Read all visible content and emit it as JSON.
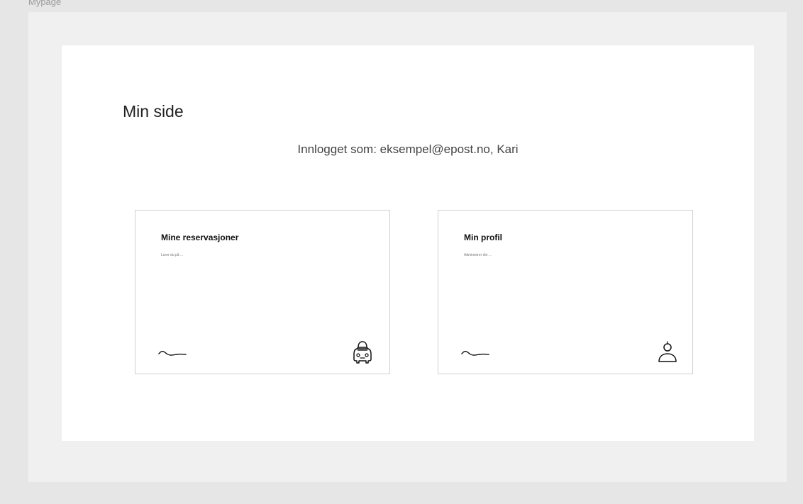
{
  "frame": {
    "label": "Mypage"
  },
  "page": {
    "title": "Min side",
    "logged_in_text": "Innlogget som: eksempel@epost.no, Kari"
  },
  "cards": [
    {
      "title": "Mine reservasjoner",
      "subtitle": "Lurer du på ...",
      "icon": "car-icon"
    },
    {
      "title": "Min profil",
      "subtitle": "Administrer din ...",
      "icon": "user-icon"
    }
  ]
}
